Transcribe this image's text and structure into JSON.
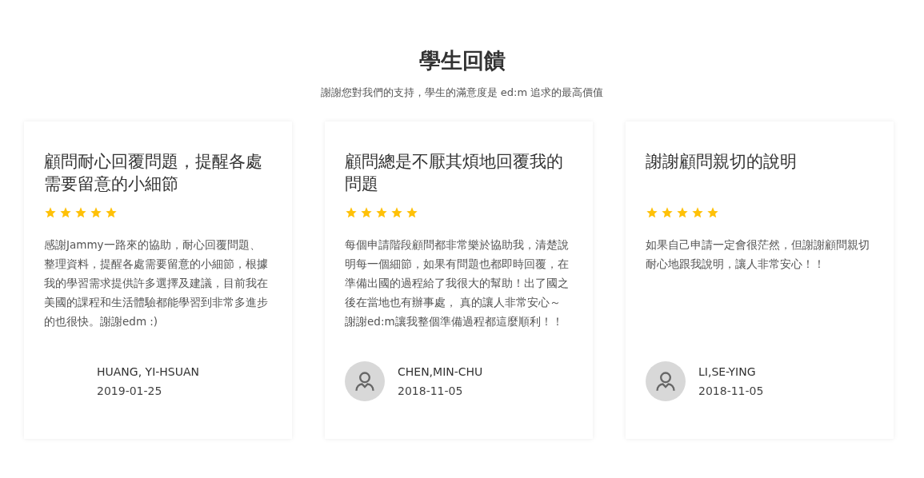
{
  "heading": "學生回饋",
  "subtitle": "謝謝您對我們的支持，學生的滿意度是 ed:m 追求的最高價值",
  "testimonials": [
    {
      "title": "顧問耐心回覆問題，提醒各處需要留意的小細節",
      "stars": 5,
      "body": "感謝Jammy一路來的協助，耐心回覆問題、整理資料，提醒各處需要留意的小細節，根據我的學習需求提供許多選擇及建議，目前我在美國的課程和生活體驗都能學習到非常多進步的也很快。謝謝edm :)",
      "name": "HUANG, YI-HSUAN",
      "date": "2019-01-25",
      "avatar": false
    },
    {
      "title": "顧問總是不厭其煩地回覆我的問題",
      "stars": 5,
      "body": "每個申請階段顧問都非常樂於協助我，清楚說明每一個細節，如果有問題也都即時回覆，在準備出國的過程給了我很大的幫助！出了國之後在當地也有辦事處， 真的讓人非常安心～謝謝ed:m讓我整個準備過程都這麼順利！！",
      "name": "CHEN,MIN-CHU",
      "date": "2018-11-05",
      "avatar": true
    },
    {
      "title": "謝謝顧問親切的說明",
      "stars": 5,
      "body": "如果自己申請一定會很茫然，但謝謝顧問親切耐心地跟我說明，讓人非常安心！！",
      "name": "LI,SE-YING",
      "date": "2018-11-05",
      "avatar": true
    }
  ]
}
